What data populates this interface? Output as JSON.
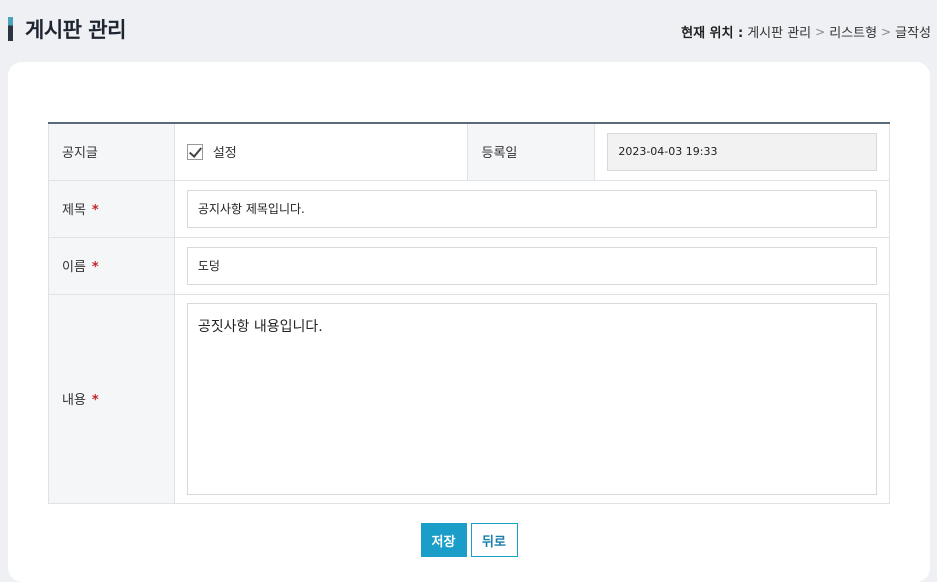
{
  "header": {
    "title": "게시판 관리",
    "breadcrumb_label": "현재 위치 :",
    "breadcrumb": [
      "게시판 관리",
      "리스트형",
      "글작성"
    ],
    "breadcrumb_sep": ">"
  },
  "form": {
    "notice_label": "공지글",
    "notice_checkbox_label": "설정",
    "notice_checked": true,
    "date_label": "등록일",
    "date_value": "2023-04-03 19:33",
    "subject_label": "제목",
    "subject_value": "공지사항 제목입니다.",
    "name_label": "이름",
    "name_value": "도덩",
    "content_label": "내용",
    "content_value": "공짓사항 내용입니다.",
    "required_mark": "*"
  },
  "actions": {
    "save_label": "저장",
    "back_label": "뒤로"
  },
  "colors": {
    "accent": "#1a9ec9",
    "required": "#c0252b"
  }
}
